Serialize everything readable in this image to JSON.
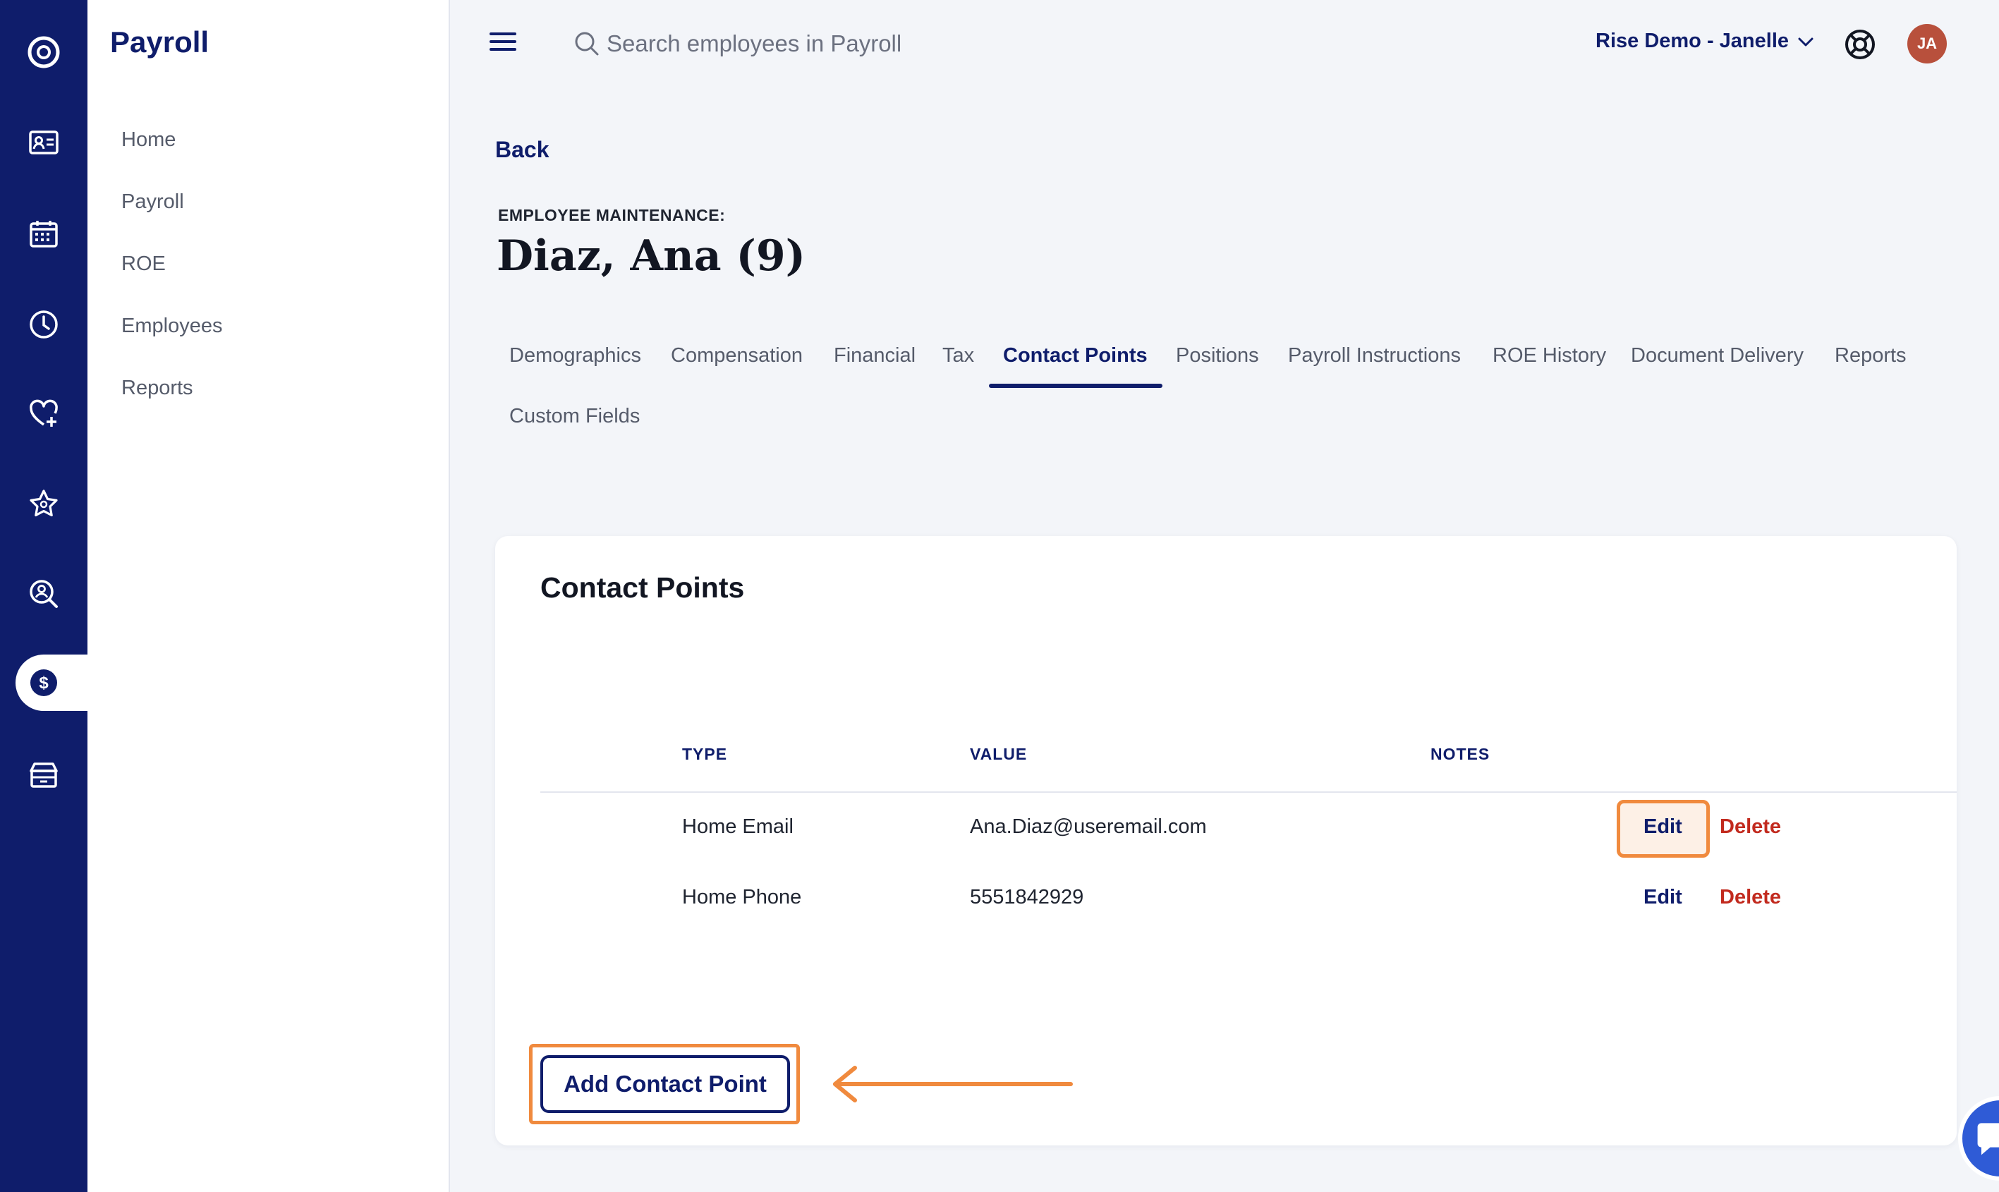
{
  "sidebar": {
    "title": "Payroll",
    "items": [
      {
        "label": "Home"
      },
      {
        "label": "Payroll"
      },
      {
        "label": "ROE"
      },
      {
        "label": "Employees"
      },
      {
        "label": "Reports"
      }
    ]
  },
  "rail": {
    "icons": [
      "logo-icon",
      "id-card-icon",
      "calendar-icon",
      "clock-icon",
      "heart-plus-icon",
      "star-icon",
      "search-person-icon",
      "dollar-icon",
      "box-icon"
    ],
    "active": "dollar-icon"
  },
  "topbar": {
    "search_placeholder": "Search employees in Payroll",
    "account_label": "Rise Demo - Janelle",
    "avatar_initials": "JA"
  },
  "header": {
    "back_label": "Back",
    "eyebrow": "EMPLOYEE MAINTENANCE:",
    "title": "Diaz, Ana (9)"
  },
  "tabs": [
    {
      "label": "Demographics"
    },
    {
      "label": "Compensation"
    },
    {
      "label": "Financial"
    },
    {
      "label": "Tax"
    },
    {
      "label": "Contact Points",
      "active": true
    },
    {
      "label": "Positions"
    },
    {
      "label": "Payroll Instructions"
    },
    {
      "label": "ROE History"
    },
    {
      "label": "Document Delivery"
    },
    {
      "label": "Reports"
    },
    {
      "label": "Custom Fields"
    }
  ],
  "card": {
    "title": "Contact Points",
    "columns": [
      "TYPE",
      "VALUE",
      "NOTES"
    ],
    "rows": [
      {
        "type": "Home Email",
        "value": "Ana.Diaz@useremail.com",
        "notes": "",
        "edit": "Edit",
        "delete": "Delete"
      },
      {
        "type": "Home Phone",
        "value": "5551842929",
        "notes": "",
        "edit": "Edit",
        "delete": "Delete"
      }
    ],
    "add_label": "Add Contact Point"
  },
  "colors": {
    "navy": "#0f1d6b",
    "danger": "#c22a1e",
    "highlight": "#f08a3e",
    "avatar": "#b8503c"
  }
}
